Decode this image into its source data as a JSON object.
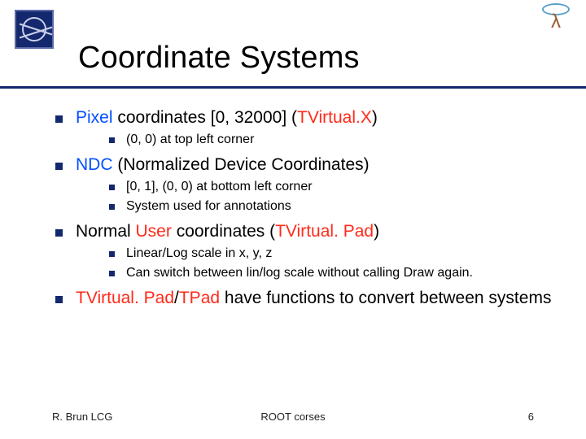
{
  "title": "Coordinate Systems",
  "bullets": {
    "b1": {
      "pre": "Pixel",
      "mid": " coordinates [0, 32000] (",
      "tv": "TVirtual.X",
      "post": ")"
    },
    "b1s1": "(0, 0) at top left corner",
    "b2": {
      "pre": "NDC",
      "post": " (Normalized Device Coordinates)"
    },
    "b2s1": "[0, 1], (0, 0) at bottom left corner",
    "b2s2": "System used for annotations",
    "b3": {
      "pre": "Normal ",
      "user": "User",
      "mid": " coordinates (",
      "tv": "TVirtual. Pad",
      "post": ")"
    },
    "b3s1": "Linear/Log scale in x, y, z",
    "b3s2": "Can switch between lin/log scale without calling Draw again.",
    "b4": {
      "tv": "TVirtual. Pad",
      "slash": "/",
      "tpad": "TPad",
      "rest": " have functions to convert between systems"
    }
  },
  "footer": {
    "left": "R. Brun  LCG",
    "center": "ROOT corses",
    "right": "6"
  }
}
